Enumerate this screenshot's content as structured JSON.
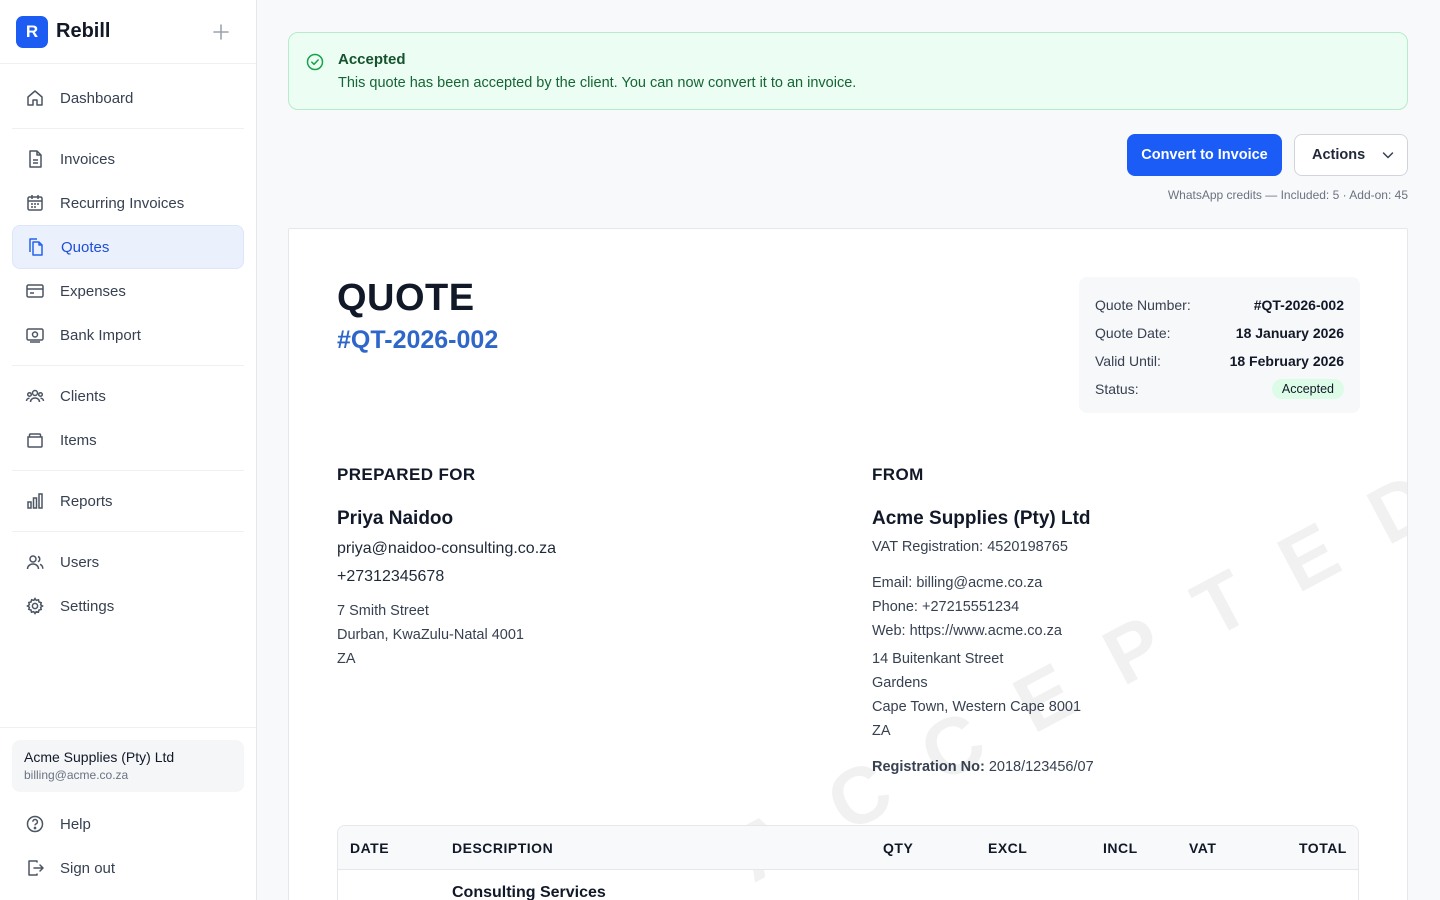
{
  "sidebar": {
    "brand": {
      "logo_letter": "R",
      "name": "Rebill"
    },
    "groups": [
      [
        {
          "label": "Dashboard",
          "icon": "home-icon"
        }
      ],
      [
        {
          "label": "Invoices",
          "icon": "document-icon"
        },
        {
          "label": "Recurring Invoices",
          "icon": "calendar-icon"
        },
        {
          "label": "Quotes",
          "icon": "copy-document-icon",
          "active": true
        },
        {
          "label": "Expenses",
          "icon": "credit-card-icon"
        },
        {
          "label": "Bank Import",
          "icon": "bank-icon"
        }
      ],
      [
        {
          "label": "Clients",
          "icon": "users-group-icon"
        },
        {
          "label": "Items",
          "icon": "box-icon"
        }
      ],
      [
        {
          "label": "Reports",
          "icon": "bar-chart-icon"
        }
      ],
      [
        {
          "label": "Users",
          "icon": "users-icon"
        },
        {
          "label": "Settings",
          "icon": "gear-icon"
        }
      ]
    ],
    "org": {
      "name": "Acme Supplies (Pty) Ltd",
      "email": "billing@acme.co.za"
    },
    "footer": [
      {
        "label": "Help",
        "icon": "help-circle-icon"
      },
      {
        "label": "Sign out",
        "icon": "sign-out-icon"
      }
    ]
  },
  "banner": {
    "title": "Accepted",
    "text": "This quote has been accepted by the client. You can now convert it to an invoice.",
    "color": "#16a34a"
  },
  "toolbar": {
    "convert_label": "Convert to Invoice",
    "actions_label": "Actions",
    "credits_text": "WhatsApp credits — Included: 5 · Add-on: 45",
    "accent": "#1a5cf5"
  },
  "quote": {
    "title": "QUOTE",
    "number": "#QT-2026-002",
    "meta": {
      "number_label": "Quote Number:",
      "number_value": "#QT-2026-002",
      "date_label": "Quote Date:",
      "date_value": "18 January 2026",
      "valid_label": "Valid Until:",
      "valid_value": "18 February 2026",
      "status_label": "Status:",
      "status_value": "Accepted"
    },
    "prepared_for": {
      "heading": "PREPARED FOR",
      "name": "Priya Naidoo",
      "email": "priya@naidoo-consulting.co.za",
      "phone": "+27312345678",
      "address": [
        "7 Smith Street",
        "Durban, KwaZulu-Natal 4001",
        "ZA"
      ]
    },
    "from": {
      "heading": "FROM",
      "name": "Acme Supplies (Pty) Ltd",
      "vat": "VAT Registration: 4520198765",
      "email": "Email: billing@acme.co.za",
      "phone": "Phone: +27215551234",
      "web": "Web: https://www.acme.co.za",
      "address": [
        "14 Buitenkant Street",
        "Gardens",
        "Cape Town, Western Cape 8001",
        "ZA"
      ],
      "reg_label": "Registration No:",
      "reg_value": "2018/123456/07"
    },
    "watermark": "ACCEPTED",
    "table": {
      "headers": [
        "DATE",
        "DESCRIPTION",
        "QTY",
        "EXCL",
        "INCL",
        "VAT",
        "TOTAL"
      ],
      "rows": [
        {
          "description": "Consulting Services"
        }
      ]
    }
  }
}
